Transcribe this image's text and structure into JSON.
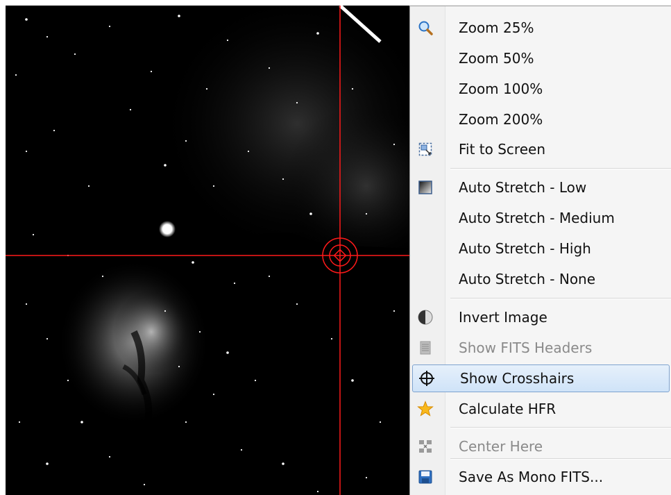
{
  "viewer": {
    "crosshair_color": "#ff1a1a",
    "crosshair_visible": true
  },
  "context_menu": {
    "items": [
      {
        "label": "Zoom 25%",
        "icon": "zoom-icon",
        "enabled": true
      },
      {
        "label": "Zoom 50%",
        "icon": "",
        "enabled": true
      },
      {
        "label": "Zoom 100%",
        "icon": "",
        "enabled": true
      },
      {
        "label": "Zoom 200%",
        "icon": "",
        "enabled": true
      },
      {
        "label": "Fit to Screen",
        "icon": "fit-screen-icon",
        "enabled": true
      },
      {
        "label": "Auto Stretch - Low",
        "icon": "gradient-stretch-icon",
        "enabled": true
      },
      {
        "label": "Auto Stretch - Medium",
        "icon": "",
        "enabled": true
      },
      {
        "label": "Auto Stretch - High",
        "icon": "",
        "enabled": true
      },
      {
        "label": "Auto Stretch - None",
        "icon": "",
        "enabled": true
      },
      {
        "label": "Invert Image",
        "icon": "invert-icon",
        "enabled": true
      },
      {
        "label": "Show FITS Headers",
        "icon": "document-icon",
        "enabled": false
      },
      {
        "label": "Show Crosshairs",
        "icon": "crosshair-icon",
        "enabled": true,
        "highlighted": true
      },
      {
        "label": "Calculate HFR",
        "icon": "star-icon",
        "enabled": true
      },
      {
        "label": "Center Here",
        "icon": "center-arrows-icon",
        "enabled": false
      },
      {
        "label": "Save As Mono FITS...",
        "icon": "save-disk-icon",
        "enabled": true
      }
    ]
  }
}
